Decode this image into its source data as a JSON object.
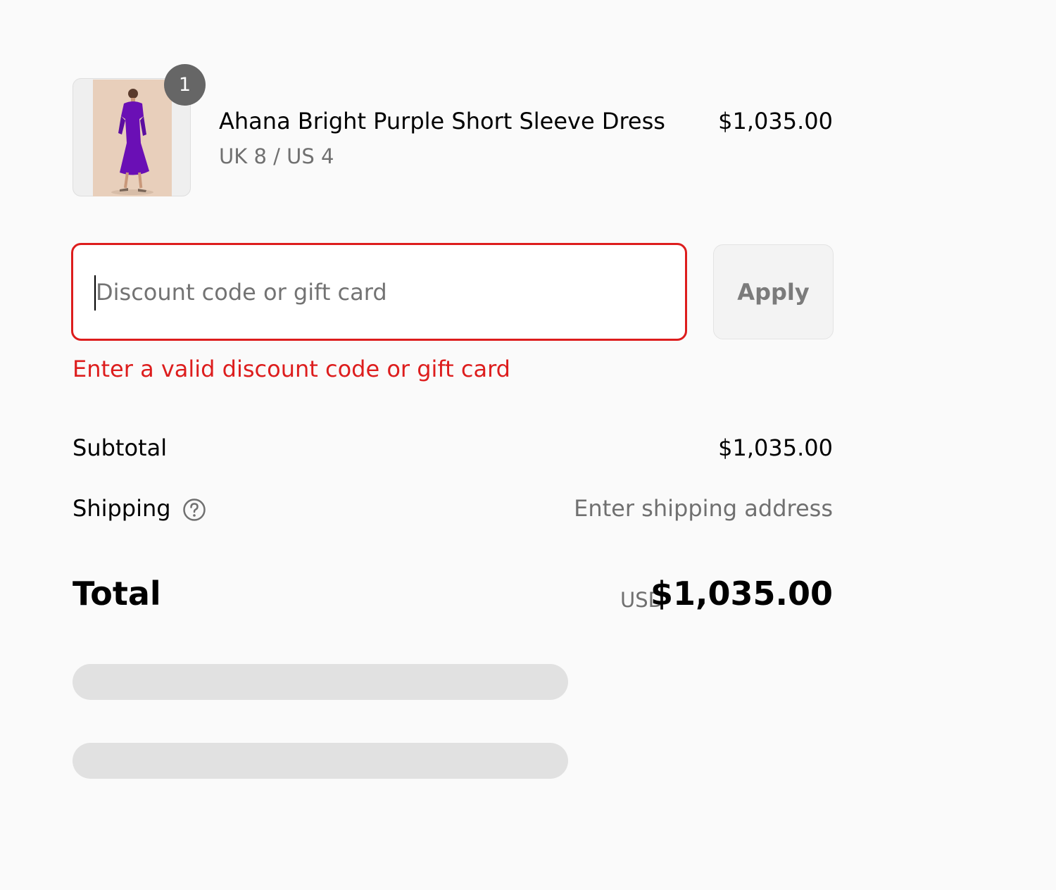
{
  "order_summary": {
    "line_item": {
      "quantity": "1",
      "name": "Ahana Bright Purple Short Sleeve Dress",
      "variant": "UK 8 / US 4",
      "price": "$1,035.00",
      "image_alt": "Model wearing purple dress"
    },
    "discount": {
      "placeholder": "Discount code or gift card",
      "value": "",
      "apply_label": "Apply",
      "error": "Enter a valid discount code or gift card",
      "error_color": "#dd1d1d"
    },
    "subtotal": {
      "label": "Subtotal",
      "value": "$1,035.00"
    },
    "shipping": {
      "label": "Shipping",
      "value": "Enter shipping address",
      "help_icon": "question-circle-icon"
    },
    "total": {
      "label": "Total",
      "currency": "USD",
      "value": "$1,035.00"
    }
  }
}
